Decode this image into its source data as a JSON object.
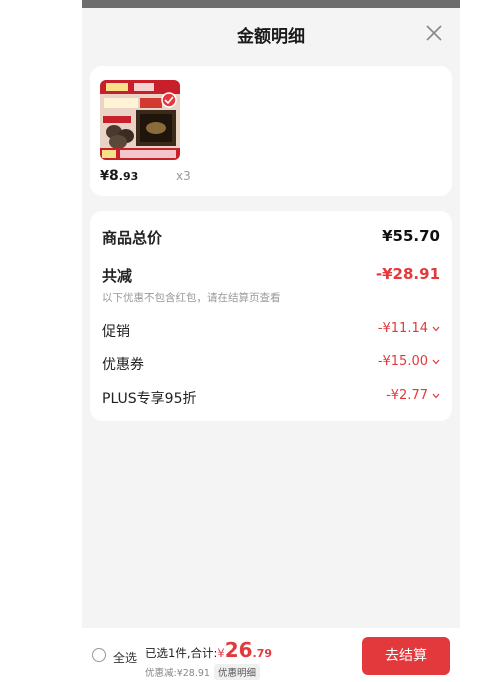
{
  "sheet": {
    "title": "金额明细"
  },
  "product": {
    "price_symbol": "¥",
    "price_int": "8",
    "price_dec": ".93",
    "quantity": "x3"
  },
  "detail": {
    "total": {
      "label": "商品总价",
      "value": "¥55.70"
    },
    "discount": {
      "label": "共减",
      "value": "-¥28.91",
      "note": "以下优惠不包含红包，请在结算页查看"
    },
    "items": [
      {
        "label": "促销",
        "value": "-¥11.14"
      },
      {
        "label": "优惠券",
        "value": "-¥15.00"
      },
      {
        "label": "PLUS专享95折",
        "value": "-¥2.77"
      }
    ]
  },
  "bottom": {
    "select_all": "全选",
    "selected_text": "已选1件,合计:",
    "yen": "¥",
    "total_int": "26",
    "total_dec": ".79",
    "discount_text": "优惠减:¥28.91",
    "detail_link": "优惠明细",
    "checkout": "去结算"
  },
  "colors": {
    "accent": "#e4393c"
  }
}
